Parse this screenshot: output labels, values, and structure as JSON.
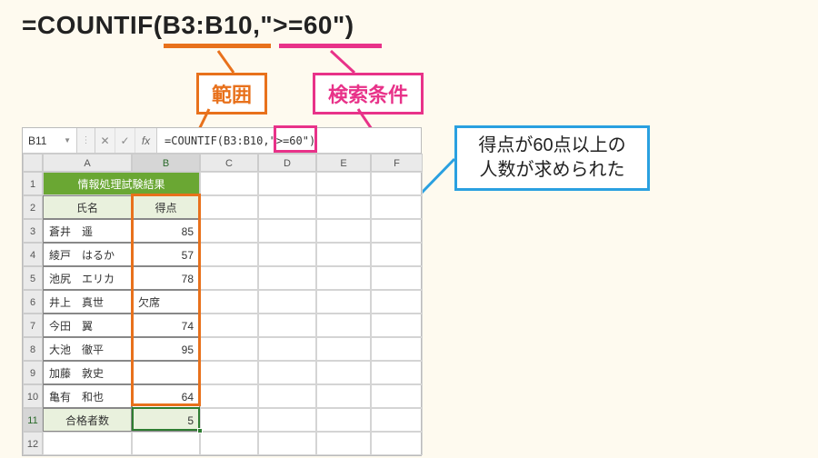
{
  "formula_display": "=COUNTIF(B3:B10,\">=60\")",
  "labels": {
    "range": "範囲",
    "condition": "検索条件"
  },
  "callout": {
    "line1": "得点が60点以上の",
    "line2": "人数が求められた"
  },
  "excel": {
    "name_box": "B11",
    "formula_bar": "=COUNTIF(B3:B10,\">=60\")",
    "col_headers": [
      "A",
      "B",
      "C",
      "D",
      "E",
      "F"
    ],
    "row_headers": [
      "1",
      "2",
      "3",
      "4",
      "5",
      "6",
      "7",
      "8",
      "9",
      "10",
      "11",
      "12"
    ],
    "merged_title": "情報処理試験結果",
    "header_row": {
      "a": "氏名",
      "b": "得点"
    },
    "rows": [
      {
        "a": "蒼井　遥",
        "b": "85"
      },
      {
        "a": "綾戸　はるか",
        "b": "57"
      },
      {
        "a": "池尻　エリカ",
        "b": "78"
      },
      {
        "a": "井上　真世",
        "b": "欠席",
        "b_align": "left"
      },
      {
        "a": "今田　翼",
        "b": "74"
      },
      {
        "a": "大池　徹平",
        "b": "95"
      },
      {
        "a": "加藤　敦史",
        "b": ""
      },
      {
        "a": "亀有　和也",
        "b": "64"
      }
    ],
    "summary": {
      "a": "合格者数",
      "b": "5"
    }
  }
}
